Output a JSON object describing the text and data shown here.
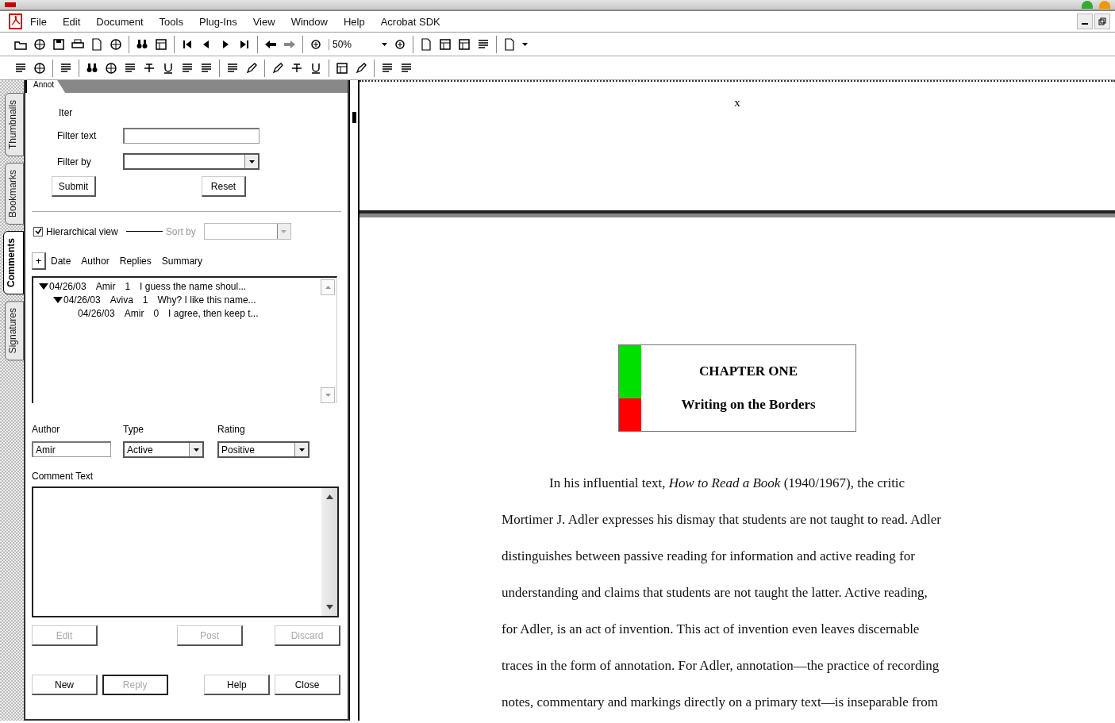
{
  "menu": [
    "File",
    "Edit",
    "Document",
    "Tools",
    "Plug-Ins",
    "View",
    "Window",
    "Help",
    "Acrobat SDK"
  ],
  "zoom": {
    "value": "50%"
  },
  "side_tabs": [
    {
      "label": "Thumbnails",
      "selected": false
    },
    {
      "label": "Bookmarks",
      "selected": false
    },
    {
      "label": "Comments",
      "selected": true
    },
    {
      "label": "Signatures",
      "selected": false
    }
  ],
  "panel": {
    "tab": "Annot",
    "filter": {
      "title": "Iter",
      "text_label": "Filter text",
      "by_label": "Filter by",
      "submit": "Submit",
      "reset": "Reset"
    },
    "hierarchical": {
      "label": "Hierarchical view",
      "checked": true
    },
    "sort": {
      "label": "Sort by",
      "disabled": true
    },
    "expand_button": "+",
    "columns": [
      "Date",
      "Author",
      "Replies",
      "Summary"
    ],
    "comments": [
      {
        "date": "04/26/03",
        "author": "Amir",
        "replies": "1",
        "summary": "I guess the name shoul...",
        "expanded": true,
        "children": [
          {
            "date": "04/26/03",
            "author": "Aviva",
            "replies": "1",
            "summary": "Why? I like this name...",
            "expanded": true,
            "children": [
              {
                "date": "04/26/03",
                "author": "Amir",
                "replies": "0",
                "summary": "I agree, then keep t..."
              }
            ]
          }
        ]
      }
    ],
    "author": {
      "label": "Author",
      "value": "Amir"
    },
    "type": {
      "label": "Type",
      "value": "Active"
    },
    "rating": {
      "label": "Rating",
      "value": "Positive"
    },
    "comment_text": {
      "label": "Comment Text"
    },
    "action_buttons": [
      {
        "label": "Edit",
        "disabled": true,
        "focused": false
      },
      {
        "label": "Post",
        "disabled": true,
        "focused": false
      },
      {
        "label": "Discard",
        "disabled": true,
        "focused": false
      }
    ],
    "dialog_buttons": [
      {
        "label": "New",
        "disabled": false,
        "focused": false
      },
      {
        "label": "Reply",
        "disabled": true,
        "focused": true
      },
      {
        "label": "Help",
        "disabled": false,
        "focused": false
      },
      {
        "label": "Close",
        "disabled": false,
        "focused": false
      }
    ]
  },
  "document": {
    "header_mark": "x",
    "chapter": {
      "title": "CHAPTER ONE",
      "subtitle": "Writing on the Borders"
    },
    "body_lines": [
      "In his influential text, *How to Read a Book* (1940/1967), the critic",
      "Mortimer J. Adler expresses his dismay that students are not taught to read.  Adler",
      "distinguishes between passive reading for information and active reading for",
      "understanding and claims that students are not taught the latter.  Active reading,",
      "for Adler, is an act of invention.  This act of invention even leaves discernable",
      "traces in the form of annotation.  For Adler, annotation—the practice of recording",
      "notes, commentary and markings directly on a primary text—is inseparable from"
    ]
  }
}
